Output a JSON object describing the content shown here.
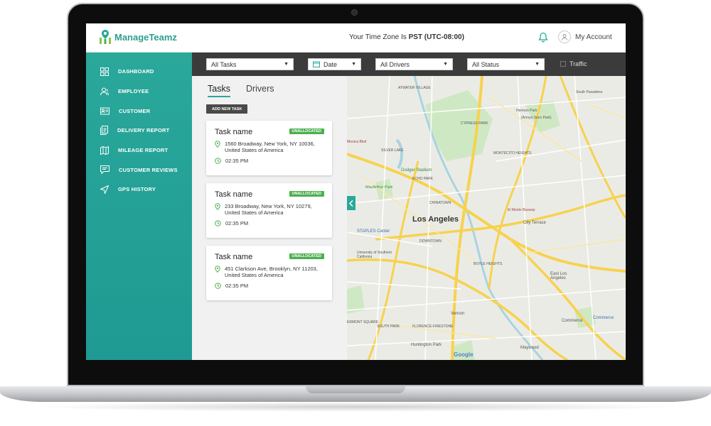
{
  "header": {
    "app_name": "ManageTeamz",
    "timezone_prefix": "Your Time Zone Is ",
    "timezone_value": "PST (UTC-08:00)",
    "account_label": "My Account"
  },
  "sidebar": {
    "items": [
      {
        "label": "DASHBOARD",
        "icon": "dashboard-icon"
      },
      {
        "label": "EMPLOYEE",
        "icon": "employee-icon"
      },
      {
        "label": "CUSTOMER",
        "icon": "customer-icon"
      },
      {
        "label": "DELIVERY REPORT",
        "icon": "delivery-report-icon"
      },
      {
        "label": "MILEAGE REPORT",
        "icon": "map-icon"
      },
      {
        "label": "CUSTOMER REVIEWS",
        "icon": "reviews-icon"
      },
      {
        "label": "GPS HISTORY",
        "icon": "gps-icon"
      }
    ]
  },
  "filters": {
    "tasks": "All Tasks",
    "date": "Date",
    "drivers": "All Drivers",
    "status": "All Status",
    "traffic": "Traffic"
  },
  "panel": {
    "tabs": [
      "Tasks",
      "Drivers"
    ],
    "add_task_label": "ADD NEW TASK",
    "tasks": [
      {
        "name": "Task name",
        "status": "UNALLOCATED",
        "address_line1": "1560 Broadway, New York, NY 10036,",
        "address_line2": "United States of America",
        "time": "02:35 PM"
      },
      {
        "name": "Task name",
        "status": "UNALLOCATED",
        "address_line1": "233 Broadway, New York, NY 10279,",
        "address_line2": "United States of America",
        "time": "02:35 PM"
      },
      {
        "name": "Task name",
        "status": "UNALLOCATED",
        "address_line1": "451 Clarkson Ave, Brooklyn, NY 11203,",
        "address_line2": "United States of America",
        "time": "02:35 PM"
      }
    ]
  },
  "map": {
    "city": "Los Angeles",
    "labels": {
      "atwater": "ATWATER VILLAGE",
      "hermon": "Hermon Park",
      "arroyo": "(Arroyo Seco Park)",
      "south_pasadena": "South Pasadena",
      "cypress": "CYPRESS PARK",
      "monica": "Monica Blvd",
      "silver_lake": "SILVER LAKE",
      "montecito": "MONTECITO HEIGHTS",
      "dodger": "Dodger Stadium",
      "echo": "ECHO PARK",
      "macarthur": "MacArthur Park",
      "chinatown": "CHINATOWN",
      "el_monte": "El Monte Busway",
      "city_terrace": "City Terrace",
      "staples": "STAPLES Center",
      "downtown": "DOWNTOWN",
      "usc": "University of Southern California",
      "boyle": "BOYLE HEIGHTS",
      "east_la": "East Los Angeles",
      "vernon": "Vernon",
      "commerce": "Commerce",
      "commerce_poi": "Commerce",
      "ermont": "ERMONT SQUARE",
      "south_park": "SOUTH PARK",
      "florence": "FLORENCE-FIRESTONE",
      "huntington": "Huntington Park",
      "maywood": "Maywood"
    },
    "google_text": "Google"
  },
  "colors": {
    "accent": "#2aa89a",
    "badge": "#4caf50",
    "filterbar": "#3b3b3b"
  }
}
